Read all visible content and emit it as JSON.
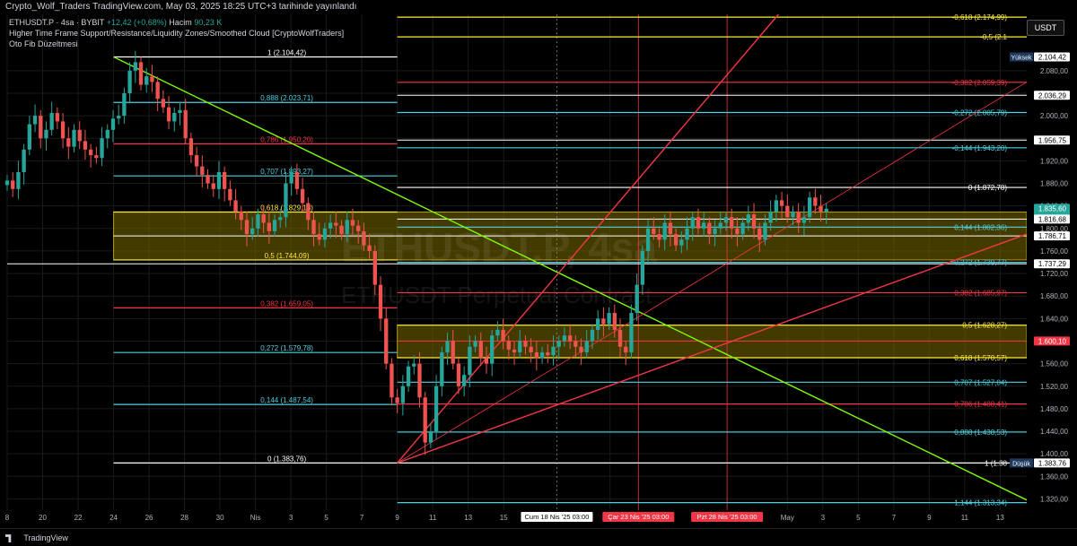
{
  "header": {
    "publish_line": "Crypto_Wolf_Traders TradingView.com, May 03, 2025 18:25 UTC+3 tarihinde yayınlandı"
  },
  "legend": {
    "symbol_line": "ETHUSDT.P · 4sa · BYBIT",
    "change": "+12,42 (+0,68%)",
    "volume_label": "Hacim",
    "volume": "90,23 K",
    "indicator_1": "Higher Time Frame Support/Resistance/Liquidity Zones/Smoothed Cloud [CryptoWolfTraders]",
    "indicator_2": "Oto Fib Düzeltmesi"
  },
  "currency_button": "USDT",
  "watermark": {
    "line1": "ETHUSDT.P, 4sa",
    "line2": "ETHUSDT Perpetual Contract"
  },
  "footer": {
    "brand": "TradingView"
  },
  "colors": {
    "up": "#26a69a",
    "down": "#ef5350",
    "yellow": "#ffeb3b",
    "cyan": "#4dd0e1",
    "red_level": "#f23645",
    "white": "#ffffff",
    "green_trend": "#7cfc00",
    "zone": "#7a6a00"
  },
  "chart_data": {
    "type": "candlestick",
    "ylim": [
      1300,
      2180
    ],
    "y_ticks": [
      "1.320,00",
      "1.360,00",
      "1.400,00",
      "1.440,00",
      "1.480,00",
      "1.520,00",
      "1.560,00",
      "1.600,00",
      "1.640,00",
      "1.680,00",
      "1.720,00",
      "1.760,00",
      "1.800,00",
      "1.840,00",
      "1.880,00",
      "1.920,00",
      "1.960,00",
      "2.000,00",
      "2.040,00",
      "2.080,00"
    ],
    "x_ticks": [
      {
        "t": 0,
        "label": "18"
      },
      {
        "t": 2,
        "label": "20"
      },
      {
        "t": 4,
        "label": "22"
      },
      {
        "t": 6,
        "label": "24"
      },
      {
        "t": 8,
        "label": "26"
      },
      {
        "t": 10,
        "label": "28"
      },
      {
        "t": 12,
        "label": "30"
      },
      {
        "t": 14,
        "label": "Nis"
      },
      {
        "t": 16,
        "label": "3"
      },
      {
        "t": 18,
        "label": "5"
      },
      {
        "t": 20,
        "label": "7"
      },
      {
        "t": 22,
        "label": "9"
      },
      {
        "t": 24,
        "label": "11"
      },
      {
        "t": 26,
        "label": "13"
      },
      {
        "t": 28,
        "label": "15"
      },
      {
        "t": 34,
        "label": "2"
      },
      {
        "t": 44,
        "label": "May"
      },
      {
        "t": 46,
        "label": "3"
      },
      {
        "t": 48,
        "label": "5"
      },
      {
        "t": 50,
        "label": "7"
      },
      {
        "t": 52,
        "label": "9"
      },
      {
        "t": 54,
        "label": "11"
      },
      {
        "t": 56,
        "label": "13"
      }
    ],
    "x_tick_first_label": "8",
    "x_axis_highlights": [
      {
        "t": 31,
        "label": "Cum 18 Nis '25   03:00",
        "style": "white"
      },
      {
        "t": 35.6,
        "label": "Çar 23 Nis '25   03:00",
        "style": "red"
      },
      {
        "t": 40.6,
        "label": "Pzt 28 Nis '25   03:00",
        "style": "red"
      }
    ],
    "fib_left": [
      {
        "label": "1 (2.104,42)",
        "value": 2104.42,
        "color": "#ffffff"
      },
      {
        "label": "0,888 (2.023,71)",
        "value": 2023.71,
        "color": "#4dd0e1"
      },
      {
        "label": "0,786 (1.950,20)",
        "value": 1950.2,
        "color": "#f23645"
      },
      {
        "label": "0,707 (1.893,27)",
        "value": 1893.27,
        "color": "#4dd0e1"
      },
      {
        "label": "0,618 (1.829,13)",
        "value": 1829.13,
        "color": "#ffeb3b"
      },
      {
        "label": "0,5 (1.744,09)",
        "value": 1744.09,
        "color": "#ffeb3b"
      },
      {
        "label": "0,382 (1.659,05)",
        "value": 1659.05,
        "color": "#f23645"
      },
      {
        "label": "0,272 (1.579,78)",
        "value": 1579.78,
        "color": "#4dd0e1"
      },
      {
        "label": "0,144 (1.487,54)",
        "value": 1487.54,
        "color": "#4dd0e1"
      },
      {
        "label": "0 (1.383,76)",
        "value": 1383.76,
        "color": "#ffffff"
      }
    ],
    "fib_right": [
      {
        "label": "-0,618 (2.174,99)",
        "value": 2174.99,
        "color": "#ffeb3b"
      },
      {
        "label": "-0,5 (2.1",
        "value": 2140.0,
        "color": "#ffeb3b"
      },
      {
        "label": "-0,382 (2.059,39)",
        "value": 2059.39,
        "color": "#f23645"
      },
      {
        "label": "-0,272 (2.005,79)",
        "value": 2005.79,
        "color": "#4dd0e1"
      },
      {
        "label": "-0,144 (1.943,20)",
        "value": 1943.2,
        "color": "#4dd0e1"
      },
      {
        "label": "0 (1.872,78)",
        "value": 1872.78,
        "color": "#ffffff"
      },
      {
        "label": "0,144 (1.802,36)",
        "value": 1802.36,
        "color": "#4dd0e1"
      },
      {
        "label": "0,272 (1.739,77)",
        "value": 1739.77,
        "color": "#4dd0e1"
      },
      {
        "label": "0,382 (1.685,97)",
        "value": 1685.97,
        "color": "#f23645"
      },
      {
        "label": "0,5 (1.628,27)",
        "value": 1628.27,
        "color": "#ffeb3b"
      },
      {
        "label": "0,618 (1.570,57)",
        "value": 1570.57,
        "color": "#ffeb3b"
      },
      {
        "label": "0,707 (1.527,04)",
        "value": 1527.04,
        "color": "#4dd0e1"
      },
      {
        "label": "0,786 (1.488,41)",
        "value": 1488.41,
        "color": "#f23645"
      },
      {
        "label": "0,888 (1.438,53)",
        "value": 1438.53,
        "color": "#4dd0e1"
      },
      {
        "label": "1 (1.38",
        "value": 1383.76,
        "color": "#ffffff"
      },
      {
        "label": "1,144 (1.313,34)",
        "value": 1313.34,
        "color": "#4dd0e1"
      }
    ],
    "axis_markers": [
      {
        "label": "2.104,42",
        "value": 2104.42,
        "bg": "#ffffff",
        "fg": "#000000",
        "tag": "Yüksek"
      },
      {
        "label": "2.036,29",
        "value": 2036.29,
        "bg": "#ffffff",
        "fg": "#000000"
      },
      {
        "label": "1.956,75",
        "value": 1956.75,
        "bg": "#ffffff",
        "fg": "#000000"
      },
      {
        "label": "1.835,60",
        "value": 1835.6,
        "bg": "#26a69a",
        "fg": "#ffffff",
        "sub": "24:27"
      },
      {
        "label": "1.816,68",
        "value": 1816.68,
        "bg": "#ffffff",
        "fg": "#000000"
      },
      {
        "label": "1.786,71",
        "value": 1786.71,
        "bg": "#ffffff",
        "fg": "#000000"
      },
      {
        "label": "1.737,29",
        "value": 1737.29,
        "bg": "#ffffff",
        "fg": "#000000"
      },
      {
        "label": "1.600,10",
        "value": 1600.1,
        "bg": "#f23645",
        "fg": "#ffffff"
      },
      {
        "label": "1.383,76",
        "value": 1383.76,
        "bg": "#ffffff",
        "fg": "#000000",
        "tag": "Düşük"
      }
    ],
    "zones": [
      {
        "t0": 6,
        "t1": 57.5,
        "top": 1829.13,
        "bottom": 1744.09
      },
      {
        "t0": 22,
        "t1": 57.5,
        "top": 1628.27,
        "bottom": 1570.57
      }
    ],
    "horizontal_lines": [
      {
        "value": 2036.29,
        "color": "#ffffff",
        "t0": 22
      },
      {
        "value": 1956.75,
        "color": "#ffffff",
        "t0": 22
      },
      {
        "value": 1816.68,
        "color": "#ffffff",
        "t0": 22
      },
      {
        "value": 1786.71,
        "color": "#ffffff",
        "t0": 6
      },
      {
        "value": 1737.29,
        "color": "#ffffff",
        "t0": 0
      },
      {
        "value": 1600.1,
        "color": "#f23645",
        "t0": 22
      }
    ],
    "trendlines": [
      {
        "t0": 6,
        "v0": 2104.42,
        "t1": 57.5,
        "v1": 1318,
        "color": "#7cfc00"
      },
      {
        "t0": 22,
        "v0": 1383.76,
        "t1": 43.5,
        "v1": 2180,
        "color": "#f23645"
      },
      {
        "t0": 22,
        "v0": 1383.76,
        "t1": 57.5,
        "v1": 1790,
        "color": "#f23645"
      },
      {
        "t0": 22,
        "v0": 1383.76,
        "t1": 57.5,
        "v1": 2060,
        "color": "#f23645",
        "thin": true
      }
    ],
    "vertical_lines": [
      {
        "t": 31,
        "color": "#888888",
        "dashed": true
      },
      {
        "t": 35.6,
        "color": "#f23645"
      },
      {
        "t": 40.6,
        "color": "#f23645"
      }
    ],
    "candles_close": [
      1885,
      1870,
      1900,
      1940,
      1985,
      2000,
      1960,
      1975,
      2005,
      1990,
      1960,
      1945,
      1975,
      1955,
      1940,
      1930,
      1925,
      1960,
      1975,
      1995,
      2000,
      2040,
      2080,
      2095,
      2055,
      2070,
      2060,
      2030,
      2015,
      1990,
      2005,
      2010,
      1960,
      1930,
      1910,
      1895,
      1880,
      1870,
      1900,
      1870,
      1850,
      1830,
      1815,
      1790,
      1800,
      1825,
      1810,
      1795,
      1815,
      1820,
      1880,
      1900,
      1870,
      1845,
      1815,
      1790,
      1780,
      1800,
      1810,
      1805,
      1790,
      1815,
      1805,
      1795,
      1770,
      1760,
      1700,
      1640,
      1560,
      1500,
      1490,
      1520,
      1555,
      1560,
      1500,
      1420,
      1440,
      1520,
      1580,
      1600,
      1560,
      1520,
      1540,
      1590,
      1600,
      1570,
      1560,
      1610,
      1620,
      1600,
      1585,
      1580,
      1600,
      1590,
      1580,
      1570,
      1580,
      1575,
      1590,
      1600,
      1610,
      1600,
      1590,
      1580,
      1600,
      1620,
      1640,
      1630,
      1650,
      1620,
      1590,
      1580,
      1650,
      1700,
      1760,
      1800,
      1790,
      1780,
      1810,
      1790,
      1770,
      1780,
      1800,
      1820,
      1800,
      1810,
      1790,
      1800,
      1810,
      1820,
      1800,
      1790,
      1810,
      1825,
      1800,
      1780,
      1810,
      1830,
      1850,
      1840,
      1820,
      1830,
      1810,
      1820,
      1855,
      1840,
      1830,
      1835
    ]
  }
}
